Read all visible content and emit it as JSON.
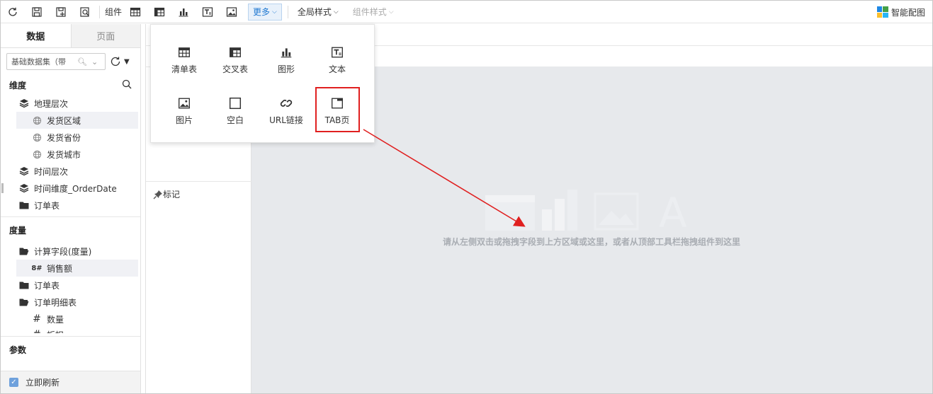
{
  "toolbar": {
    "component_label": "组件",
    "more_label": "更多",
    "global_style_label": "全局样式",
    "component_style_label": "组件样式",
    "smart_layout_label": "智能配图"
  },
  "left_panel": {
    "tabs": [
      {
        "label": "数据"
      },
      {
        "label": "页面"
      }
    ],
    "dataset_select": "基础数据集（带",
    "dimensions_heading": "维度",
    "dimensions": [
      {
        "label": "地理层次",
        "icon": "layers-icon"
      },
      {
        "label": "发货区域",
        "icon": "globe-icon"
      },
      {
        "label": "发货省份",
        "icon": "globe-icon"
      },
      {
        "label": "发货城市",
        "icon": "globe-icon"
      },
      {
        "label": "时间层次",
        "icon": "layers-icon"
      },
      {
        "label": "时间维度_OrderDate",
        "icon": "layers-icon"
      },
      {
        "label": "订单表",
        "icon": "folder-icon"
      }
    ],
    "measures_heading": "度量",
    "measures": [
      {
        "label": "计算字段(度量)",
        "icon": "folder-open-icon"
      },
      {
        "label": "销售额",
        "icon": "calc-field-icon"
      },
      {
        "label": "订单表",
        "icon": "folder-icon"
      },
      {
        "label": "订单明细表",
        "icon": "folder-open-icon"
      },
      {
        "label": "数量",
        "icon": "hash-icon"
      },
      {
        "label": "折扣",
        "icon": "hash-icon"
      }
    ],
    "params_heading": "参数",
    "auto_refresh_label": "立即刷新",
    "auto_refresh_checked": true
  },
  "middle": {
    "mark_label": "标记"
  },
  "canvas": {
    "hint": "请从左侧双击或拖拽字段到上方区域或这里，或者从顶部工具栏拖拽组件到这里"
  },
  "more_menu": {
    "items": [
      {
        "label": "清单表",
        "icon": "list-table-icon"
      },
      {
        "label": "交叉表",
        "icon": "cross-table-icon"
      },
      {
        "label": "图形",
        "icon": "bar-chart-icon"
      },
      {
        "label": "文本",
        "icon": "text-box-icon"
      },
      {
        "label": "图片",
        "icon": "image-icon"
      },
      {
        "label": "空白",
        "icon": "blank-icon"
      },
      {
        "label": "URL链接",
        "icon": "link-icon"
      },
      {
        "label": "TAB页",
        "icon": "tab-page-icon"
      }
    ],
    "highlighted": "TAB页"
  },
  "colors": {
    "accent": "#1f78d1",
    "highlight_red": "#e02020",
    "canvas_bg": "#e7e9ec"
  }
}
